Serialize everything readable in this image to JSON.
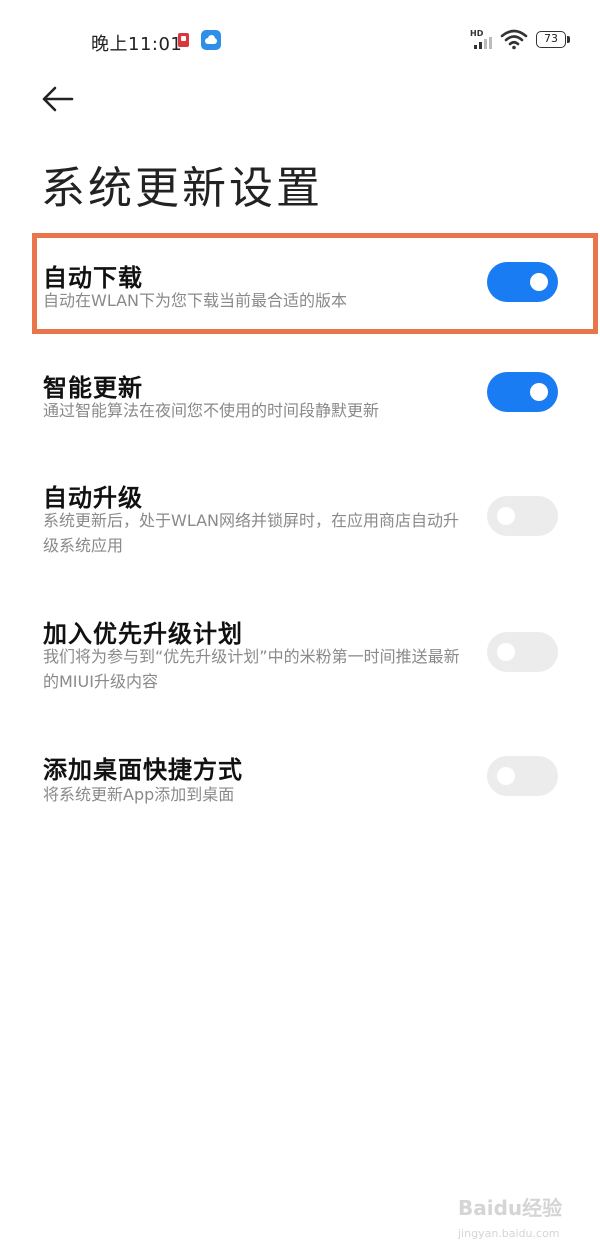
{
  "status_bar": {
    "time": "晚上11:01",
    "network_label": "HD",
    "battery": "73"
  },
  "header": {
    "title": "系统更新设置"
  },
  "settings": [
    {
      "title": "自动下载",
      "desc": "自动在WLAN下为您下载当前最合适的版本",
      "enabled": true
    },
    {
      "title": "智能更新",
      "desc": "通过智能算法在夜间您不使用的时间段静默更新",
      "enabled": true
    },
    {
      "title": "自动升级",
      "desc": "系统更新后，处于WLAN网络并锁屏时，在应用商店自动升级系统应用",
      "enabled": false
    },
    {
      "title": "加入优先升级计划",
      "desc": "我们将为参与到“优先升级计划”中的米粉第一时间推送最新的MIUI升级内容",
      "enabled": false
    },
    {
      "title": "添加桌面快捷方式",
      "desc": "将系统更新App添加到桌面",
      "enabled": false
    }
  ],
  "colors": {
    "toggle_on": "#1a7cf2",
    "toggle_off": "#ececec",
    "highlight": "#e8764a"
  },
  "watermark": {
    "brand": "Baidu经验",
    "url": "jingyan.baidu.com"
  }
}
